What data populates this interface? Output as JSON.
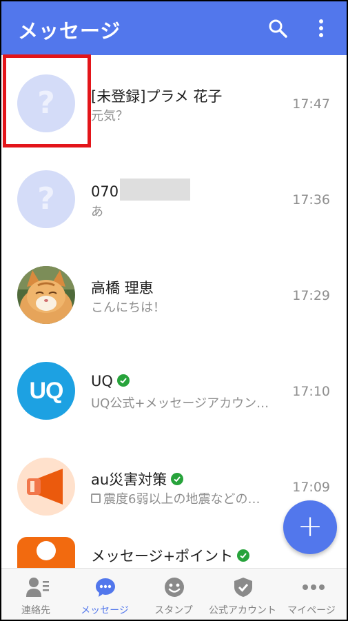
{
  "header": {
    "title": "メッセージ",
    "search_icon": "search-icon",
    "more_icon": "more-vertical-icon",
    "background": "#5277ec"
  },
  "conversations": [
    {
      "name": "[未登録]プラメ 花子",
      "preview": "元気？",
      "time": "17:47",
      "avatar": "unknown-contact",
      "verified": false
    },
    {
      "name": "070",
      "preview": "あ",
      "time": "17:36",
      "avatar": "unknown-contact",
      "verified": false,
      "redacted_number": true
    },
    {
      "name": "高橋 理恵",
      "preview": "こんにちは！",
      "time": "17:29",
      "avatar": "cat-photo",
      "verified": false
    },
    {
      "name": "UQ",
      "preview": "UQ公式+メッセージアカウン…",
      "time": "17:10",
      "avatar": "uq-logo",
      "verified": true
    },
    {
      "name": "au災害対策",
      "preview": "震度6弱以上の地震などの…",
      "time": "17:09",
      "avatar": "megaphone-logo",
      "verified": true,
      "preview_icon": "image-icon"
    },
    {
      "name": "メッセージ+ポイント",
      "preview": "",
      "time": "",
      "avatar": "point-logo",
      "verified": true,
      "partially_visible": true
    }
  ],
  "avatar_letters": {
    "unknown": "?",
    "uq": "UQ"
  },
  "fab": {
    "icon": "plus-icon",
    "label": "+"
  },
  "bottom_nav": [
    {
      "label": "連絡先",
      "icon": "contacts-icon",
      "active": false
    },
    {
      "label": "メッセージ",
      "icon": "message-bubble-icon",
      "active": true
    },
    {
      "label": "スタンプ",
      "icon": "smiley-icon",
      "active": false
    },
    {
      "label": "公式アカウント",
      "icon": "shield-check-icon",
      "active": false
    },
    {
      "label": "マイページ",
      "icon": "more-horizontal-icon",
      "active": false
    }
  ],
  "colors": {
    "accent": "#5277ec",
    "highlight": "#e3151a",
    "verified": "#27a33b",
    "uq": "#1da1e2",
    "au": "#eb5a0d"
  }
}
